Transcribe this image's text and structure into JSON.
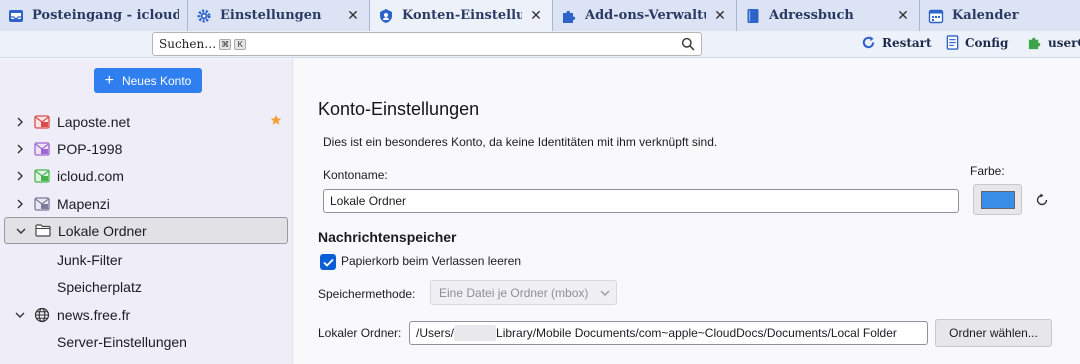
{
  "tabs": [
    {
      "label": "Posteingang - icloud.com",
      "icon": "inbox-icon",
      "closable": false,
      "active": false
    },
    {
      "label": "Einstellungen",
      "icon": "gear-icon",
      "closable": true,
      "active": false
    },
    {
      "label": "Konten-Einstellungen",
      "icon": "account-settings-icon",
      "closable": true,
      "active": true
    },
    {
      "label": "Add-ons-Verwaltung",
      "icon": "puzzle-icon",
      "closable": true,
      "active": false
    },
    {
      "label": "Adressbuch",
      "icon": "address-book-icon",
      "closable": true,
      "active": false
    },
    {
      "label": "Kalender",
      "icon": "calendar-icon",
      "closable": true,
      "active": false
    }
  ],
  "toolbar": {
    "search_placeholder": "Suchen…",
    "shortcut_keys": [
      "⌘",
      "K"
    ],
    "restart_label": "Restart",
    "config_label": "Config",
    "userchrome_label": "userCh"
  },
  "sidebar": {
    "new_account_label": "Neues Konto",
    "accounts": [
      {
        "label": "Laposte.net",
        "icon": "mail-account-icon",
        "color": "#d94c4c",
        "expanded": false,
        "favorite": true
      },
      {
        "label": "POP-1998",
        "icon": "mail-account-icon",
        "color": "#a066d3",
        "expanded": false
      },
      {
        "label": "icloud.com",
        "icon": "mail-account-icon",
        "color": "#47b34f",
        "expanded": false
      },
      {
        "label": "Mapenzi",
        "icon": "mail-account-icon",
        "color": "#7a7a9a",
        "expanded": false
      },
      {
        "label": "Lokale Ordner",
        "icon": "folder-icon",
        "expanded": true,
        "selected": true
      },
      {
        "label": "news.free.fr",
        "icon": "globe-icon",
        "expanded": true
      }
    ],
    "lokale_sub": [
      "Junk-Filter",
      "Speicherplatz"
    ],
    "news_sub": [
      "Server-Einstellungen"
    ]
  },
  "main": {
    "title": "Konto-Einstellungen",
    "description": "Dies ist ein besonderes Konto, da keine Identitäten mit ihm verknüpft sind.",
    "kontoname_label": "Kontoname:",
    "kontoname_value": "Lokale Ordner",
    "farbe_label": "Farbe:",
    "farbe_value": "#3b8ee8",
    "section_storage": "Nachrichtenspeicher",
    "empty_trash_label": "Papierkorb beim Verlassen leeren",
    "empty_trash_checked": true,
    "storage_method_label": "Speichermethode:",
    "storage_method_value": "Eine Datei je Ordner (mbox)",
    "local_folder_label": "Lokaler Ordner:",
    "local_folder_prefix": "/Users/",
    "local_folder_suffix": "Library/Mobile Documents/com~apple~CloudDocs/Documents/Local Folder",
    "choose_folder_label": "Ordner wählen..."
  }
}
